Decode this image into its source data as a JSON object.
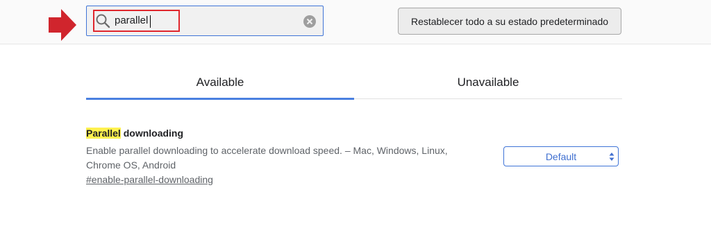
{
  "search": {
    "value": "parallel",
    "icon": "search-icon",
    "clear_icon": "clear-icon"
  },
  "reset_button": {
    "label": "Restablecer todo a su estado predeterminado"
  },
  "tabs": [
    {
      "label": "Available",
      "active": true
    },
    {
      "label": "Unavailable",
      "active": false
    }
  ],
  "experiment": {
    "title_highlight": "Parallel",
    "title_rest": " downloading",
    "description": "Enable parallel downloading to accelerate download speed. – Mac, Windows, Linux, Chrome OS, Android",
    "link": "#enable-parallel-downloading",
    "select_value": "Default"
  },
  "colors": {
    "accent": "#4a80e0",
    "annotation_red": "#e0262d",
    "highlight_yellow": "#fff14f"
  }
}
